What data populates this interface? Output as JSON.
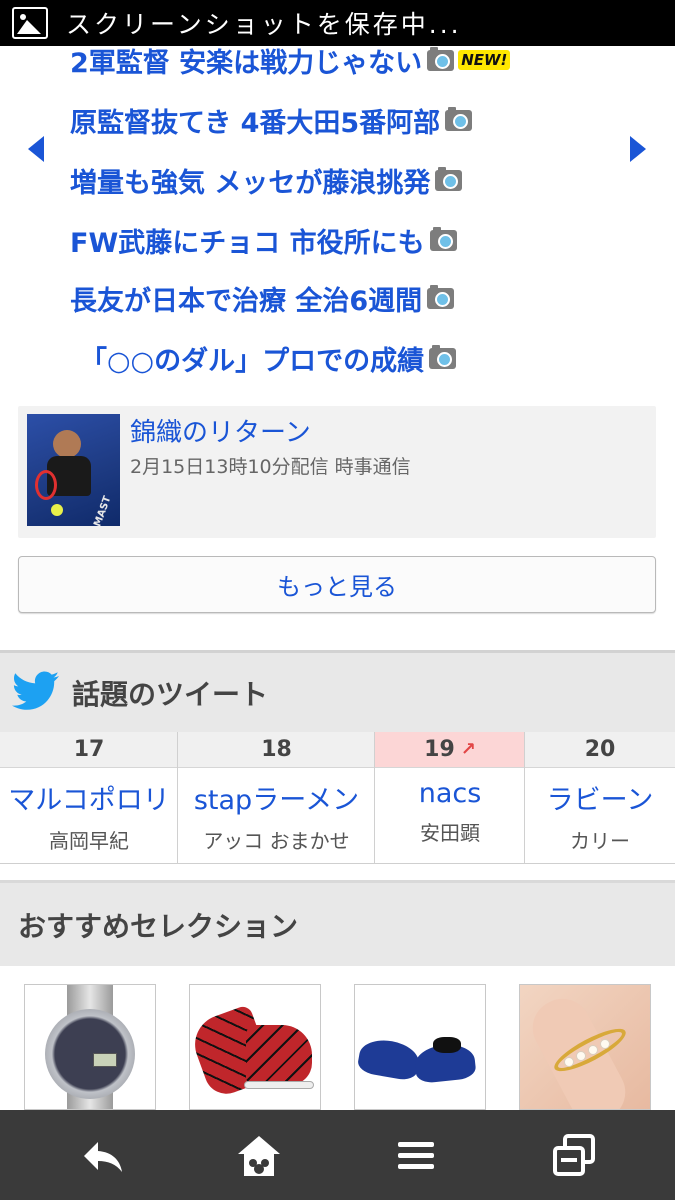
{
  "status_bar": {
    "text": "スクリーンショットを保存中..."
  },
  "news": {
    "headlines": [
      {
        "text": "2軍監督 安楽は戦力じゃない",
        "new_badge": "NEW!"
      },
      {
        "text": "原監督抜てき 4番大田5番阿部"
      },
      {
        "text": "増量も強気 メッセが藤浪挑発"
      },
      {
        "text": "FW武藤にチョコ 市役所にも"
      },
      {
        "text": "長友が日本で治療 全治6週間"
      },
      {
        "text": "「○○のダル」プロでの成績"
      }
    ],
    "feature": {
      "title": "錦織のリターン",
      "meta": "2月15日13時10分配信 時事通信",
      "thumb_text": "MAST"
    },
    "more_label": "もっと見る"
  },
  "tweets": {
    "title": "話題のツイート",
    "items": [
      {
        "rank": "17",
        "word": "マルコポロリ",
        "sub": "高岡早紀"
      },
      {
        "rank": "18",
        "word": "stapラーメン",
        "sub": "アッコ おまかせ"
      },
      {
        "rank": "19",
        "word": "nacs",
        "sub": "安田顕",
        "trend": "up"
      },
      {
        "rank": "20",
        "word": "ラビーン",
        "sub": "カリー"
      }
    ]
  },
  "recommend": {
    "title": "おすすめセレクション",
    "items": [
      "watch",
      "red-slip-on-shoes",
      "navy-ballet-flats",
      "pearl-ring"
    ]
  },
  "bottom_nav": {
    "items": [
      "back-icon",
      "home-icon",
      "menu-icon",
      "tabs-icon"
    ]
  },
  "colors": {
    "link": "#1a55d6",
    "accent_up": "#e24646",
    "nav_bg": "#3a3a3a",
    "twitter": "#1da1f2"
  }
}
